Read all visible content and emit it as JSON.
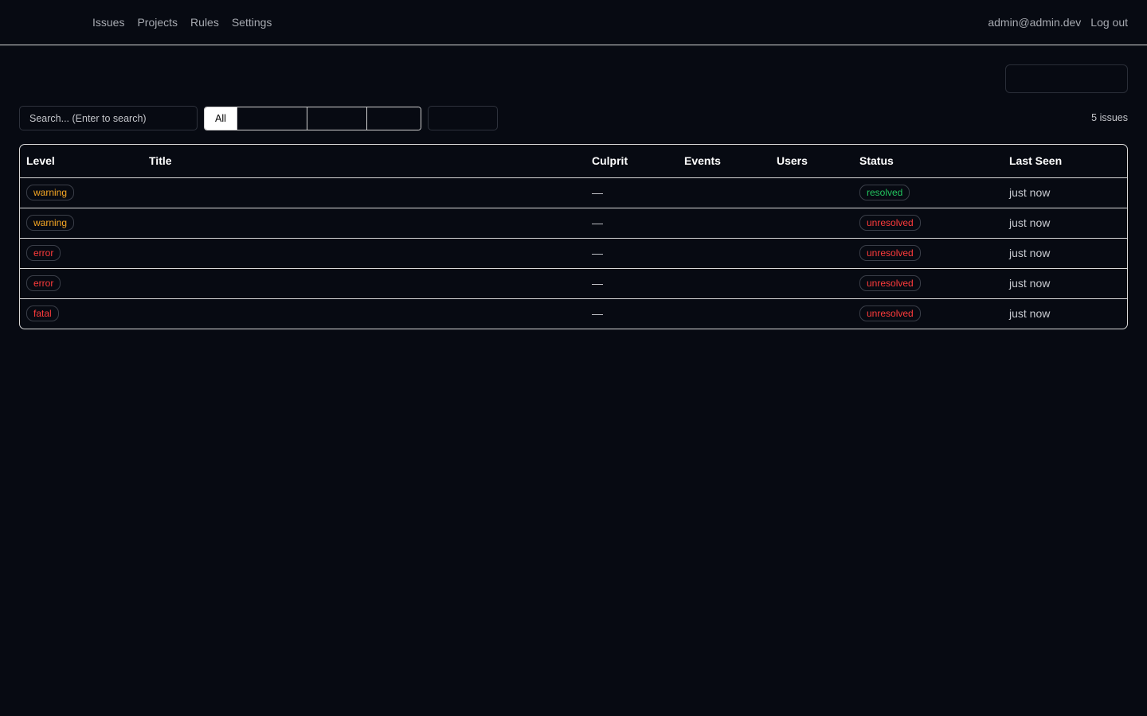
{
  "nav": {
    "items": [
      {
        "label": "Issues"
      },
      {
        "label": "Projects"
      },
      {
        "label": "Rules"
      },
      {
        "label": "Settings"
      }
    ],
    "user_email": "admin@admin.dev",
    "logout_label": "Log out"
  },
  "filters": {
    "search_placeholder": "Search... (Enter to search)",
    "segments": [
      {
        "label": "All",
        "active": true
      },
      {
        "label": ""
      },
      {
        "label": ""
      },
      {
        "label": ""
      }
    ],
    "count_label": "5 issues"
  },
  "table": {
    "headers": {
      "level": "Level",
      "title": "Title",
      "culprit": "Culprit",
      "events": "Events",
      "users": "Users",
      "status": "Status",
      "last_seen": "Last Seen"
    },
    "rows": [
      {
        "level": "warning",
        "title": "",
        "culprit": "—",
        "events": "",
        "users": "",
        "status": "resolved",
        "last_seen": "just now"
      },
      {
        "level": "warning",
        "title": "",
        "culprit": "—",
        "events": "",
        "users": "",
        "status": "unresolved",
        "last_seen": "just now"
      },
      {
        "level": "error",
        "title": "",
        "culprit": "—",
        "events": "",
        "users": "",
        "status": "unresolved",
        "last_seen": "just now"
      },
      {
        "level": "error",
        "title": "",
        "culprit": "—",
        "events": "",
        "users": "",
        "status": "unresolved",
        "last_seen": "just now"
      },
      {
        "level": "fatal",
        "title": "",
        "culprit": "—",
        "events": "",
        "users": "",
        "status": "unresolved",
        "last_seen": "just now"
      }
    ]
  },
  "colors": {
    "warning": "#f5a623",
    "error": "#ff3b3b",
    "fatal": "#ff3b3b",
    "resolved": "#22c55e",
    "unresolved": "#ff3b3b"
  }
}
